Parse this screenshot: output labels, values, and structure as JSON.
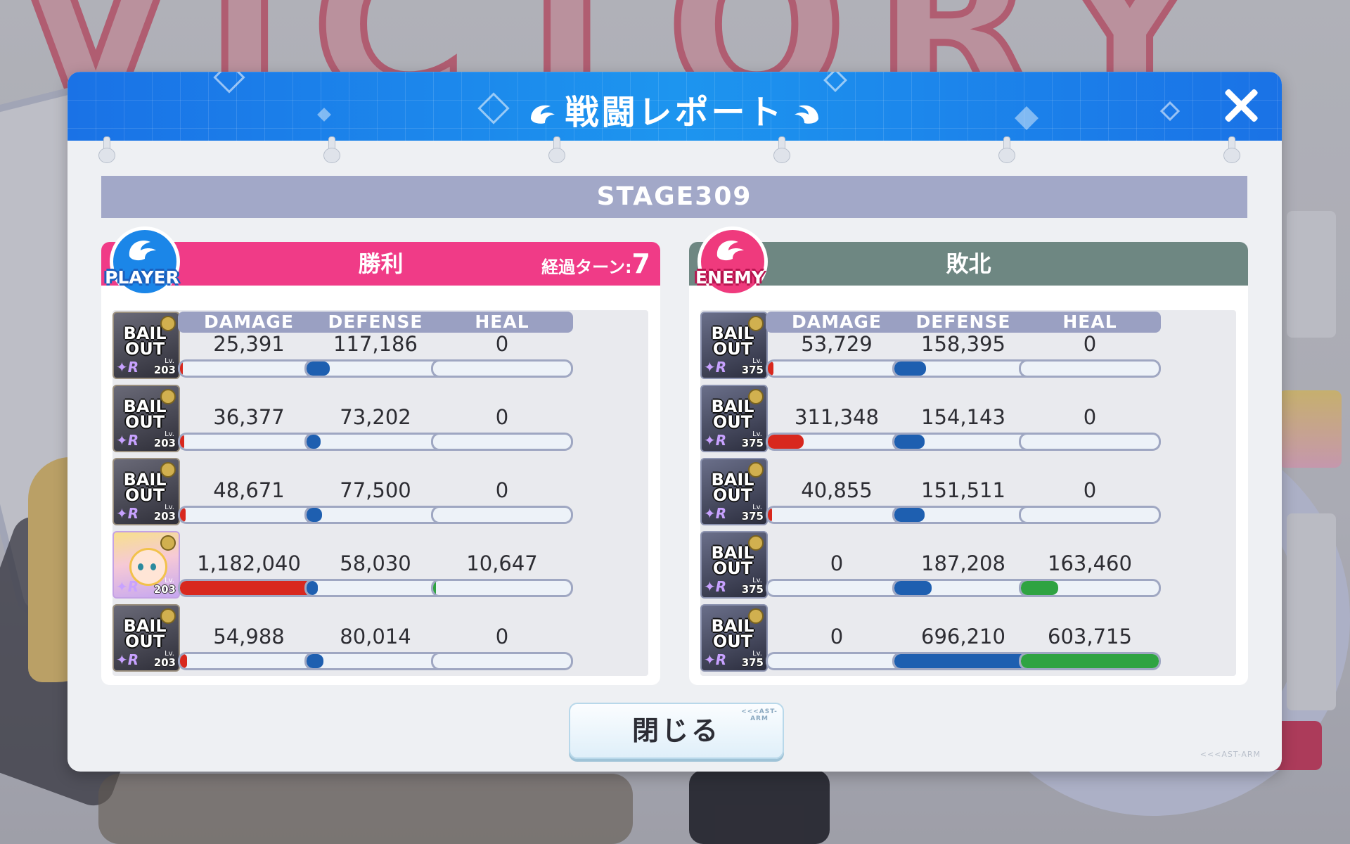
{
  "background": {
    "banner_text": "VICTORY"
  },
  "modal": {
    "title": "戦闘レポート",
    "stage": "STAGE309",
    "close_button": "閉じる",
    "watermark": "<<<AST-ARM"
  },
  "columns": [
    "DAMAGE",
    "DEFENSE",
    "HEAL"
  ],
  "player": {
    "badge": "PLAYER",
    "result": "勝利",
    "turn_label": "経過ターン:",
    "turn_value": "7",
    "units": [
      {
        "name": "BAIL OUT",
        "level_tag": "Lv.",
        "level": "203",
        "damage": "25,391",
        "defense": "117,186",
        "heal": "0",
        "damage_fill": 0.02,
        "defense_fill": 0.17,
        "heal_fill": 0
      },
      {
        "name": "BAIL OUT",
        "level_tag": "Lv.",
        "level": "203",
        "damage": "36,377",
        "defense": "73,202",
        "heal": "0",
        "damage_fill": 0.03,
        "defense_fill": 0.1,
        "heal_fill": 0
      },
      {
        "name": "BAIL OUT",
        "level_tag": "Lv.",
        "level": "203",
        "damage": "48,671",
        "defense": "77,500",
        "heal": "0",
        "damage_fill": 0.04,
        "defense_fill": 0.11,
        "heal_fill": 0
      },
      {
        "name": "",
        "level_tag": "Lv.",
        "level": "203",
        "damage": "1,182,040",
        "defense": "58,030",
        "heal": "10,647",
        "damage_fill": 1.0,
        "defense_fill": 0.08,
        "heal_fill": 0.02
      },
      {
        "name": "BAIL OUT",
        "level_tag": "Lv.",
        "level": "203",
        "damage": "54,988",
        "defense": "80,014",
        "heal": "0",
        "damage_fill": 0.05,
        "defense_fill": 0.12,
        "heal_fill": 0
      }
    ]
  },
  "enemy": {
    "badge": "ENEMY",
    "result": "敗北",
    "units": [
      {
        "name": "BAIL OUT",
        "level_tag": "Lv.",
        "level": "375",
        "damage": "53,729",
        "defense": "158,395",
        "heal": "0",
        "damage_fill": 0.04,
        "defense_fill": 0.23,
        "heal_fill": 0
      },
      {
        "name": "BAIL OUT",
        "level_tag": "Lv.",
        "level": "375",
        "damage": "311,348",
        "defense": "154,143",
        "heal": "0",
        "damage_fill": 0.26,
        "defense_fill": 0.22,
        "heal_fill": 0
      },
      {
        "name": "BAIL OUT",
        "level_tag": "Lv.",
        "level": "375",
        "damage": "40,855",
        "defense": "151,511",
        "heal": "0",
        "damage_fill": 0.03,
        "defense_fill": 0.22,
        "heal_fill": 0
      },
      {
        "name": "BAIL OUT",
        "level_tag": "Lv.",
        "level": "375",
        "damage": "0",
        "defense": "187,208",
        "heal": "163,460",
        "damage_fill": 0,
        "defense_fill": 0.27,
        "heal_fill": 0.27
      },
      {
        "name": "BAIL OUT",
        "level_tag": "Lv.",
        "level": "375",
        "damage": "0",
        "defense": "696,210",
        "heal": "603,715",
        "damage_fill": 0,
        "defense_fill": 1.0,
        "heal_fill": 1.0
      }
    ]
  },
  "colors": {
    "header_blue": "#1d8cef",
    "player_pink": "#f03b87",
    "enemy_gray": "#6e8782",
    "damage_red": "#d8281e",
    "defense_blue": "#1e5fb0",
    "heal_green": "#2fa342",
    "column_header": "#9aa0c2",
    "stage_bar": "#a2a8c8"
  }
}
